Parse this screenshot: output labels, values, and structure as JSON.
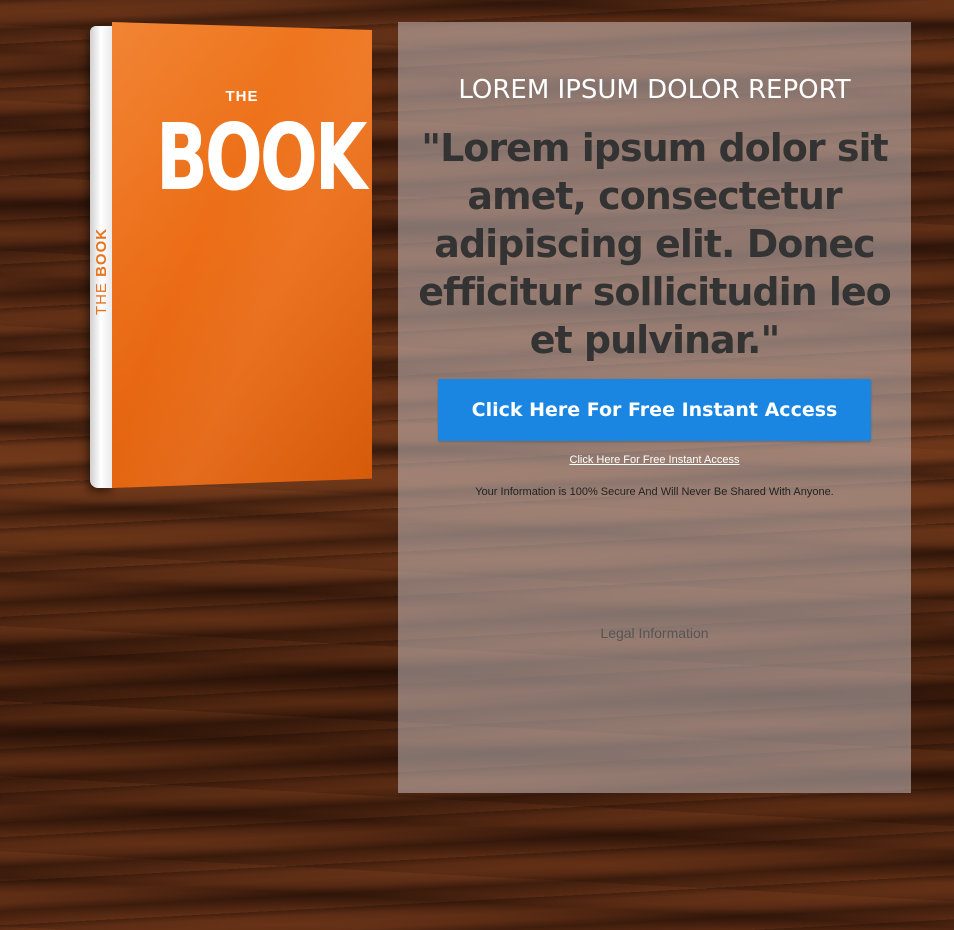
{
  "book": {
    "cover_small": "THE",
    "cover_title": "BOOK",
    "spine_prefix": "THE",
    "spine_title": "BOOK"
  },
  "panel": {
    "report_title": "LOREM IPSUM DOLOR REPORT",
    "headline": "\"Lorem ipsum dolor sit amet, consectetur adipiscing elit. Donec efficitur sollicitudin leo et pulvinar.\"",
    "cta_button_label": "Click Here For Free Instant Access",
    "cta_link_label": "Click Here For Free Instant Access",
    "secure_text": "Your Information is 100% Secure And Will Never Be Shared With Anyone.",
    "legal_label": "Legal Information"
  },
  "colors": {
    "book_orange": "#ec6d16",
    "button_blue": "#1a86e2",
    "headline_text": "#333333",
    "wood_background": "#4a2412"
  }
}
